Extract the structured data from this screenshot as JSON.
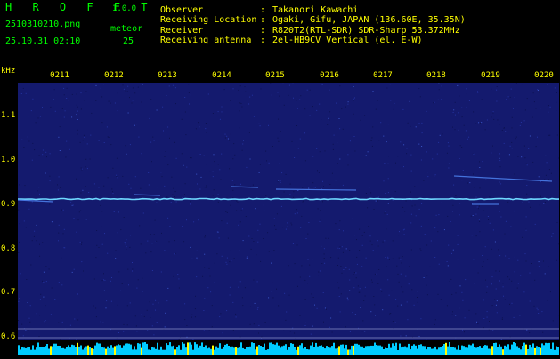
{
  "header": {
    "app_title": "H R O F F T",
    "version": "1.0.0",
    "filename": "2510310210.png",
    "timestamp": "25.10.31 02:10",
    "meteor_label": "meteor",
    "meteor_count": "25",
    "fields": [
      {
        "label": "Observer",
        "value": "Takanori Kawachi"
      },
      {
        "label": "Receiving Location",
        "value": "Ogaki, Gifu, JAPAN (136.60E, 35.35N)"
      },
      {
        "label": "Receiver",
        "value": "R820T2(RTL-SDR) SDR-Sharp 53.372MHz"
      },
      {
        "label": "Receiving antenna",
        "value": "2el-HB9CV Vertical (el. E-W)"
      }
    ],
    "separator": ":"
  },
  "axes": {
    "y_unit": "kHz",
    "y_ticks": [
      "1.1",
      "1.0",
      "0.9",
      "0.8",
      "0.7",
      "0.6"
    ],
    "x_ticks": [
      "0211",
      "0212",
      "0213",
      "0214",
      "0215",
      "0216",
      "0217",
      "0218",
      "0219",
      "0220"
    ]
  },
  "colors": {
    "background": "#000000",
    "plot_bg": "#141a6e",
    "label": "#00ff00",
    "tick": "#ffff00",
    "signal": "#6fd8ff",
    "bar": "#00ccff"
  }
}
